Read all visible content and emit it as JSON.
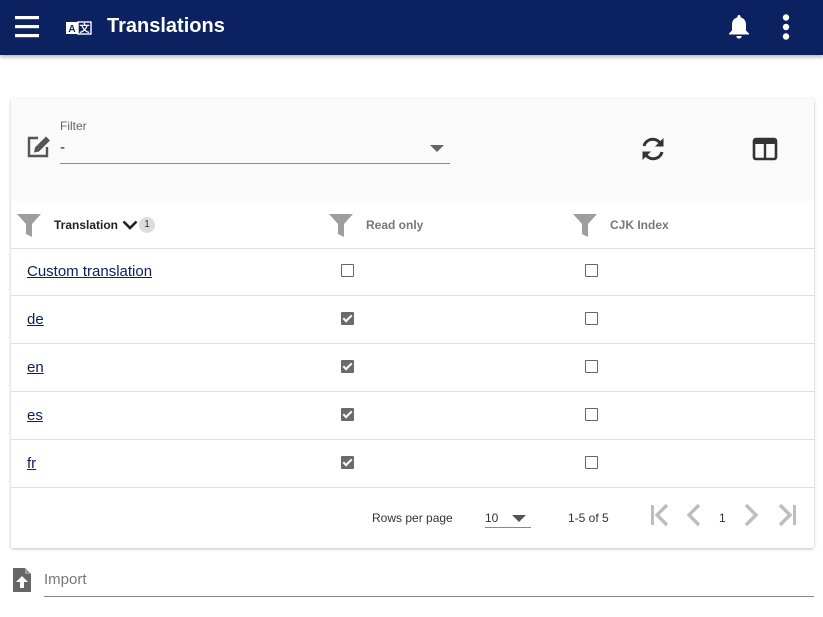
{
  "appbar": {
    "title": "Translations",
    "icons": [
      "menu-icon",
      "translate-icon",
      "bell-icon",
      "more-vert-icon"
    ],
    "color": "#0b2160"
  },
  "toolbar": {
    "filter_label": "Filter",
    "filter_value": "-",
    "icons": [
      "edit-icon",
      "refresh-icon",
      "view-columns-icon"
    ]
  },
  "table": {
    "columns": [
      {
        "label": "Translation",
        "sort_order": "1"
      },
      {
        "label": "Read only"
      },
      {
        "label": "CJK Index"
      }
    ],
    "rows": [
      {
        "name": "Custom translation",
        "read_only": false,
        "cjk_index": false
      },
      {
        "name": "de",
        "read_only": true,
        "cjk_index": false
      },
      {
        "name": "en",
        "read_only": true,
        "cjk_index": false
      },
      {
        "name": "es",
        "read_only": true,
        "cjk_index": false
      },
      {
        "name": "fr",
        "read_only": true,
        "cjk_index": false
      }
    ]
  },
  "pagination": {
    "rows_per_page_label": "Rows per page",
    "rows_per_page": "10",
    "range": "1-5 of 5",
    "page": "1"
  },
  "import": {
    "placeholder": "Import"
  }
}
